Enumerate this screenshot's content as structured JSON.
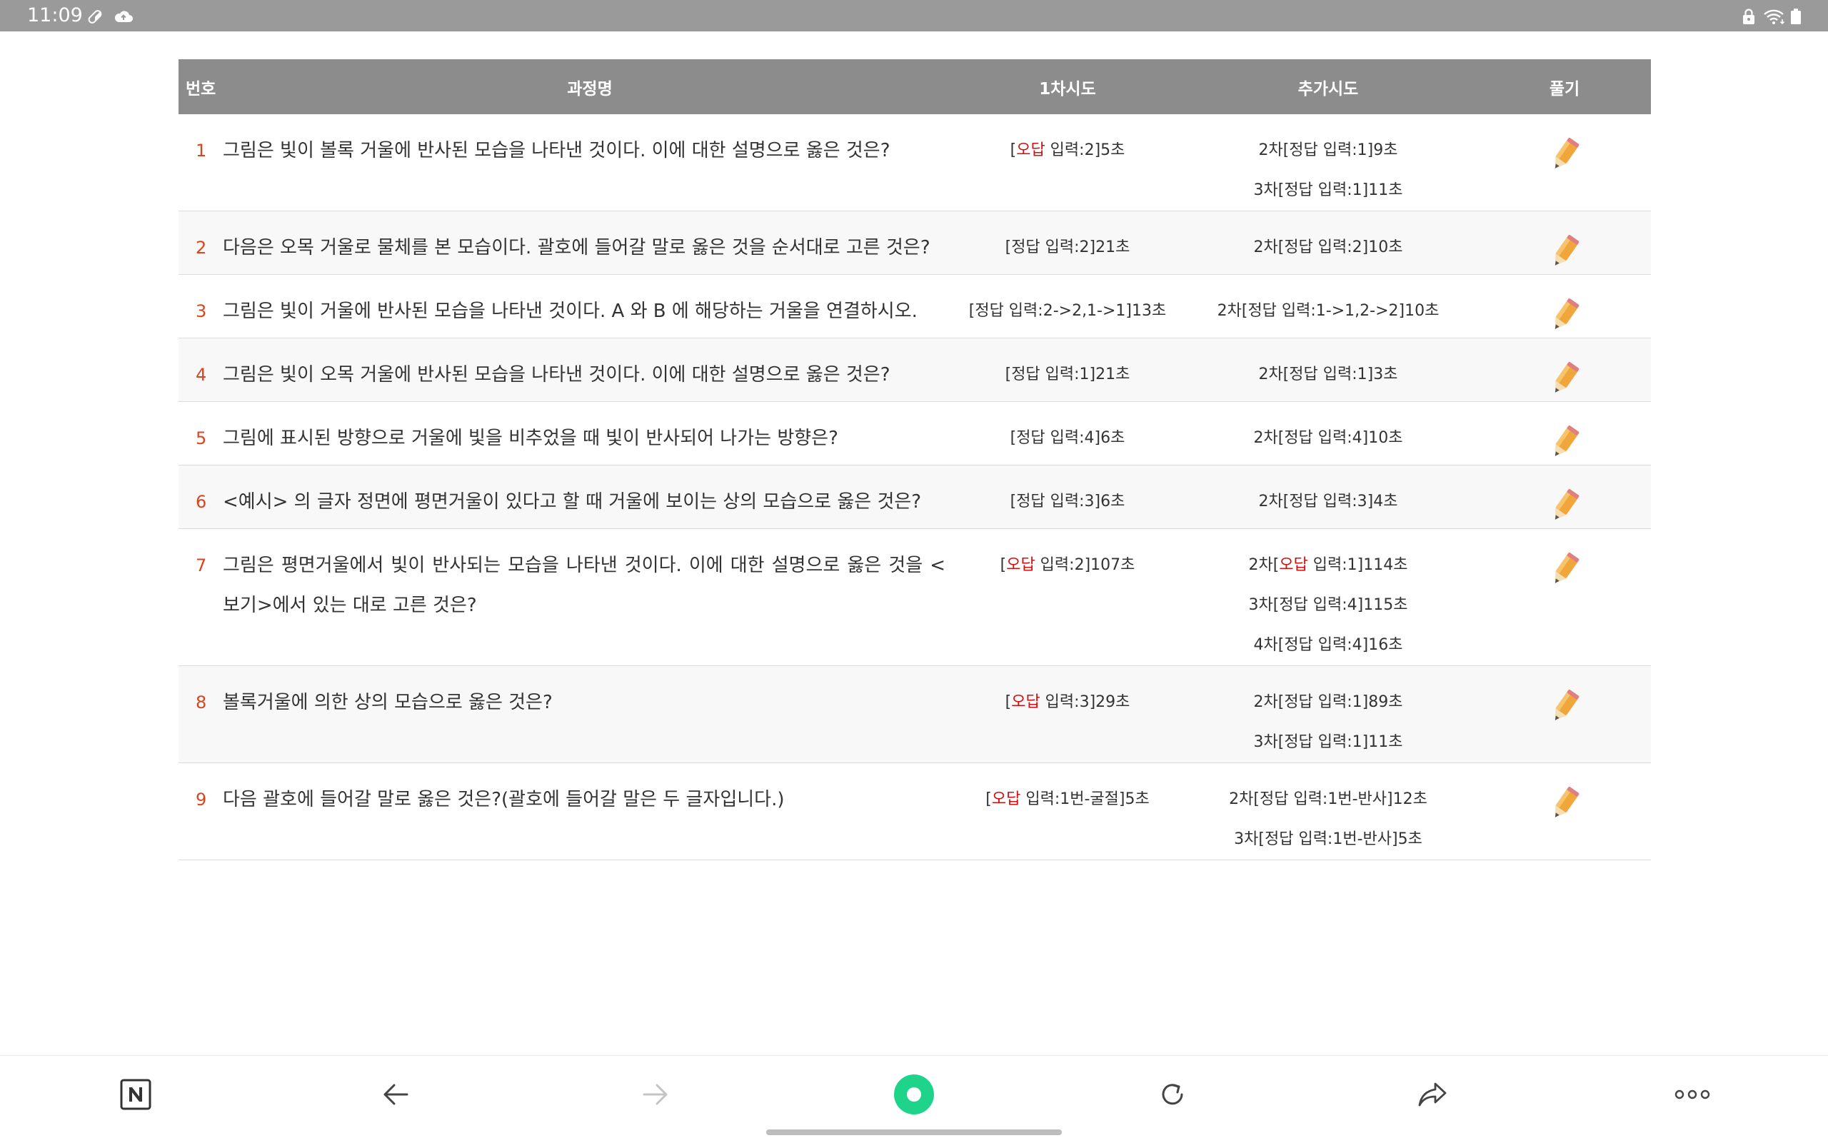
{
  "status_bar": {
    "time": "11:09",
    "left_icons": [
      "pill-icon",
      "cloud-upload-icon"
    ],
    "right_icons": [
      "lock-icon",
      "wifi-icon",
      "battery-icon"
    ]
  },
  "table": {
    "headers": {
      "number": "번호",
      "title": "과정명",
      "first": "1차시도",
      "extra": "추가시도",
      "solve": "풀기"
    },
    "rows": [
      {
        "no": "1",
        "title": "그림은 빛이 볼록 거울에 반사된 모습을 나타낸 것이다. 이에 대한 설명으로 옳은 것은?",
        "first": {
          "prefix": "[",
          "wrong": "오답",
          "text": " 입력:2]5초"
        },
        "extra": [
          {
            "prefix": "2차[정답 입력:1]9초",
            "wrong": "",
            "text": ""
          },
          {
            "prefix": "3차[정답 입력:1]11초",
            "wrong": "",
            "text": ""
          }
        ]
      },
      {
        "no": "2",
        "title": "다음은 오목 거울로 물체를 본 모습이다. 괄호에 들어갈 말로 옳은 것을 순서대로 고른 것은?",
        "first": {
          "prefix": "[정답 입력:2]21초",
          "wrong": "",
          "text": ""
        },
        "extra": [
          {
            "prefix": "2차[정답 입력:2]10초",
            "wrong": "",
            "text": ""
          }
        ]
      },
      {
        "no": "3",
        "title": "그림은 빛이 거울에 반사된 모습을 나타낸 것이다. A 와 B 에 해당하는 거울을 연결하시오.",
        "first": {
          "prefix": "[정답 입력:2->2,1->1]13초",
          "wrong": "",
          "text": ""
        },
        "extra": [
          {
            "prefix": "2차[정답 입력:1->1,2->2]10초",
            "wrong": "",
            "text": ""
          }
        ]
      },
      {
        "no": "4",
        "title": "그림은 빛이 오목 거울에 반사된 모습을 나타낸 것이다. 이에 대한 설명으로 옳은 것은?",
        "first": {
          "prefix": "[정답 입력:1]21초",
          "wrong": "",
          "text": ""
        },
        "extra": [
          {
            "prefix": "2차[정답 입력:1]3초",
            "wrong": "",
            "text": ""
          }
        ]
      },
      {
        "no": "5",
        "title": "그림에 표시된 방향으로 거울에 빛을 비추었을 때 빛이 반사되어 나가는 방향은?",
        "first": {
          "prefix": "[정답 입력:4]6초",
          "wrong": "",
          "text": ""
        },
        "extra": [
          {
            "prefix": "2차[정답 입력:4]10초",
            "wrong": "",
            "text": ""
          }
        ]
      },
      {
        "no": "6",
        "title": "<예시> 의 글자 정면에 평면거울이 있다고 할 때 거울에 보이는 상의 모습으로 옳은 것은?",
        "first": {
          "prefix": "[정답 입력:3]6초",
          "wrong": "",
          "text": ""
        },
        "extra": [
          {
            "prefix": "2차[정답 입력:3]4초",
            "wrong": "",
            "text": ""
          }
        ]
      },
      {
        "no": "7",
        "title": "그림은 평면거울에서 빛이 반사되는 모습을 나타낸 것이다. 이에 대한 설명으로 옳은 것을 <보기>에서 있는 대로 고른 것은?",
        "first": {
          "prefix": "[",
          "wrong": "오답",
          "text": " 입력:2]107초"
        },
        "extra": [
          {
            "prefix": "2차[",
            "wrong": "오답",
            "text": " 입력:1]114초"
          },
          {
            "prefix": "3차[정답 입력:4]115초",
            "wrong": "",
            "text": ""
          },
          {
            "prefix": "4차[정답 입력:4]16초",
            "wrong": "",
            "text": ""
          }
        ]
      },
      {
        "no": "8",
        "title": "볼록거울에 의한 상의 모습으로 옳은 것은?",
        "first": {
          "prefix": "[",
          "wrong": "오답",
          "text": " 입력:3]29초"
        },
        "extra": [
          {
            "prefix": "2차[정답 입력:1]89초",
            "wrong": "",
            "text": ""
          },
          {
            "prefix": "3차[정답 입력:1]11초",
            "wrong": "",
            "text": ""
          }
        ]
      },
      {
        "no": "9",
        "title": "다음 괄호에 들어갈 말로 옳은 것은?(괄호에 들어갈 말은 두 글자입니다.)",
        "first": {
          "prefix": "[",
          "wrong": "오답",
          "text": " 입력:1번-굴절]5초"
        },
        "extra": [
          {
            "prefix": "2차[정답 입력:1번-반사]12초",
            "wrong": "",
            "text": ""
          },
          {
            "prefix": "3차[정답 입력:1번-반사]5초",
            "wrong": "",
            "text": ""
          }
        ]
      }
    ]
  },
  "nav_bar": {
    "buttons": [
      {
        "name": "naver-home-button",
        "icon": "naver-n-icon"
      },
      {
        "name": "back-button",
        "icon": "arrow-left-icon"
      },
      {
        "name": "forward-button",
        "icon": "arrow-right-icon"
      },
      {
        "name": "green-dot-button",
        "icon": "green-dot-icon"
      },
      {
        "name": "refresh-button",
        "icon": "refresh-icon"
      },
      {
        "name": "share-button",
        "icon": "share-icon"
      },
      {
        "name": "more-button",
        "icon": "more-icon"
      }
    ]
  },
  "colors": {
    "header_bg": "#8c8c8c",
    "status_bg": "#9a9a9a",
    "row_number": "#d9451f",
    "wrong_text": "#d01010",
    "green_dot": "#1ed48a"
  }
}
